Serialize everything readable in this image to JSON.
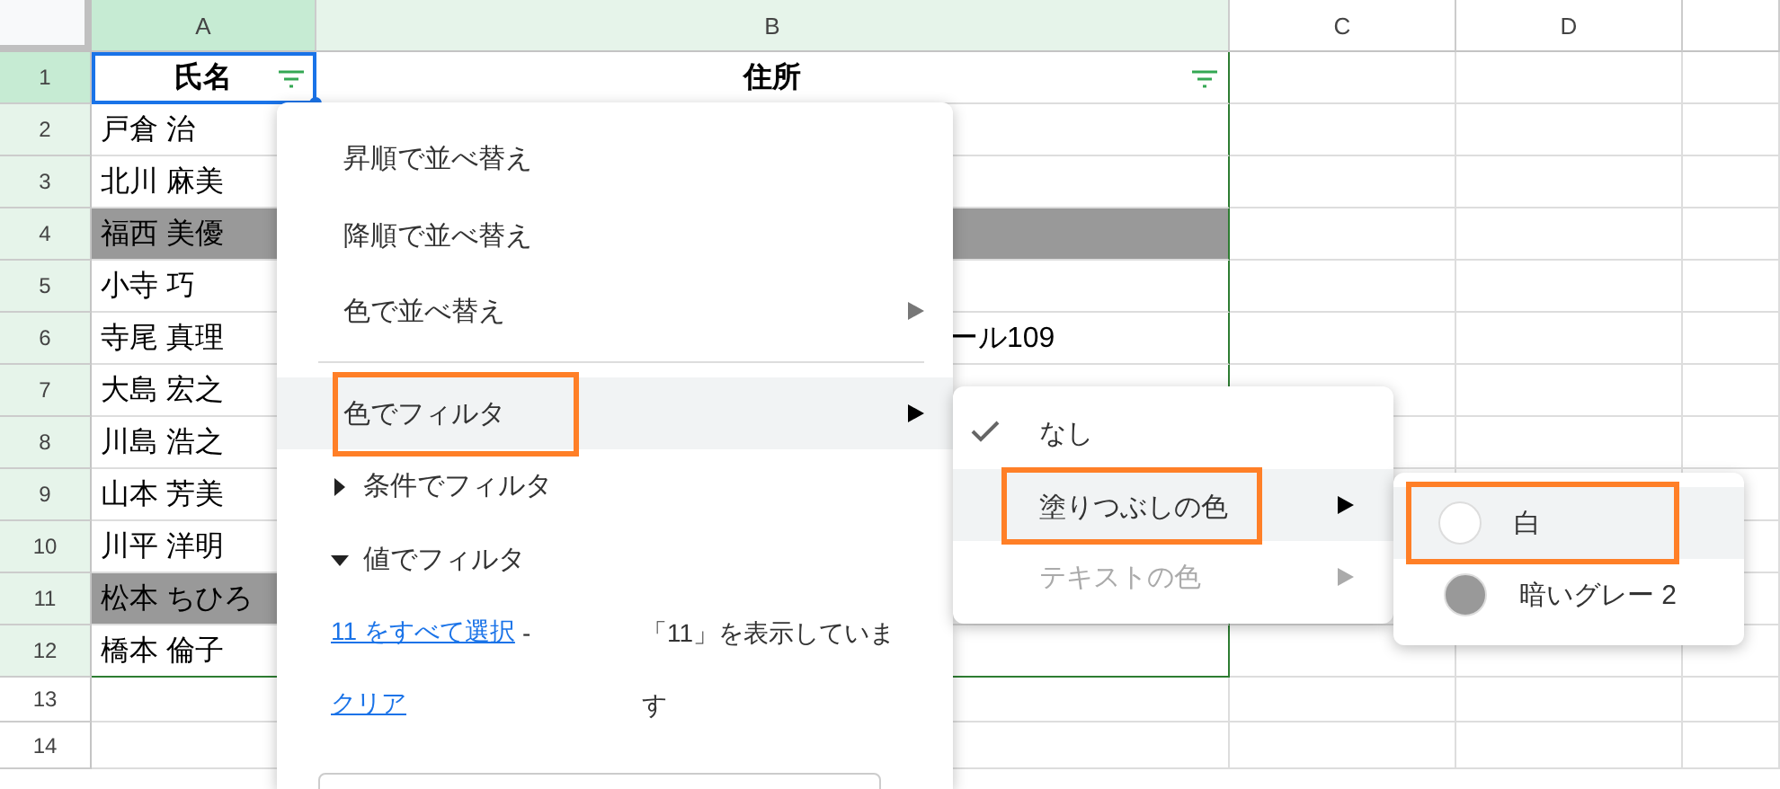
{
  "columns": [
    {
      "label": "A",
      "selected": true
    },
    {
      "label": "B",
      "selected": false
    },
    {
      "label": "C",
      "selected": false
    },
    {
      "label": "D",
      "selected": false
    }
  ],
  "rows": [
    {
      "number": "1",
      "selected": true,
      "kind": "header",
      "cells": [
        {
          "text": "氏名",
          "filter": true,
          "selected": true
        },
        {
          "text": "住所",
          "filter": true,
          "selected": false
        }
      ]
    },
    {
      "number": "2",
      "selected": false,
      "cells": [
        {
          "text": "戸倉 治"
        },
        {
          "text": ""
        }
      ]
    },
    {
      "number": "3",
      "selected": false,
      "cells": [
        {
          "text": "北川 麻美"
        },
        {
          "text": ""
        }
      ]
    },
    {
      "number": "4",
      "selected": false,
      "cells": [
        {
          "text": "福西 美優",
          "color": "#999999"
        },
        {
          "text": "",
          "color": "#999999"
        }
      ]
    },
    {
      "number": "5",
      "selected": false,
      "cells": [
        {
          "text": "小寺 巧"
        },
        {
          "text": ""
        }
      ]
    },
    {
      "number": "6",
      "selected": false,
      "cells": [
        {
          "text": "寺尾 真理"
        },
        {
          "text": "ール109"
        }
      ]
    },
    {
      "number": "7",
      "selected": false,
      "cells": [
        {
          "text": "大島 宏之"
        },
        {
          "text": ""
        }
      ]
    },
    {
      "number": "8",
      "selected": false,
      "cells": [
        {
          "text": "川島 浩之"
        },
        {
          "text": ""
        }
      ]
    },
    {
      "number": "9",
      "selected": false,
      "cells": [
        {
          "text": "山本 芳美"
        },
        {
          "text": ""
        }
      ]
    },
    {
      "number": "10",
      "selected": false,
      "cells": [
        {
          "text": "川平 洋明"
        },
        {
          "text": ""
        }
      ]
    },
    {
      "number": "11",
      "selected": false,
      "cells": [
        {
          "text": "松本 ちひろ",
          "color": "#999999"
        },
        {
          "text": ""
        }
      ]
    },
    {
      "number": "12",
      "selected": false,
      "cells": [
        {
          "text": "橋本 倫子"
        },
        {
          "text": ""
        }
      ]
    },
    {
      "number": "13",
      "selected": false,
      "cells": []
    },
    {
      "number": "14",
      "selected": false,
      "cells": []
    }
  ],
  "filter_menu": {
    "items": [
      {
        "kind": "item",
        "label": "昇順で並べ替え"
      },
      {
        "kind": "item",
        "label": "降順で並べ替え"
      },
      {
        "kind": "submenu",
        "label": "色で並べ替え",
        "highlighted": false,
        "annotated": false
      },
      {
        "kind": "divider"
      },
      {
        "kind": "submenu",
        "label": "色でフィルタ",
        "highlighted": true,
        "annotated": true
      },
      {
        "kind": "section",
        "label": "条件でフィルタ",
        "expanded": false
      },
      {
        "kind": "section",
        "label": "値でフィルタ",
        "expanded": true
      }
    ],
    "value_filter": {
      "select_all_link": "11 をすべて選択",
      "separator": "-",
      "clear_link": "クリア",
      "status": "「11」を表示しています"
    }
  },
  "color_filter_menu": {
    "items": [
      {
        "label": "なし",
        "checked": true,
        "highlighted": false,
        "disabled": false,
        "has_submenu": false,
        "annotated": false
      },
      {
        "label": "塗りつぶしの色",
        "checked": false,
        "highlighted": true,
        "disabled": false,
        "has_submenu": true,
        "annotated": true
      },
      {
        "label": "テキストの色",
        "checked": false,
        "highlighted": false,
        "disabled": true,
        "has_submenu": true,
        "annotated": false
      }
    ]
  },
  "fill_color_menu": {
    "items": [
      {
        "label": "白",
        "color": "#ffffff",
        "highlighted": true,
        "annotated": true
      },
      {
        "label": "暗いグレー 2",
        "color": "#999999",
        "highlighted": false,
        "annotated": false
      }
    ]
  }
}
